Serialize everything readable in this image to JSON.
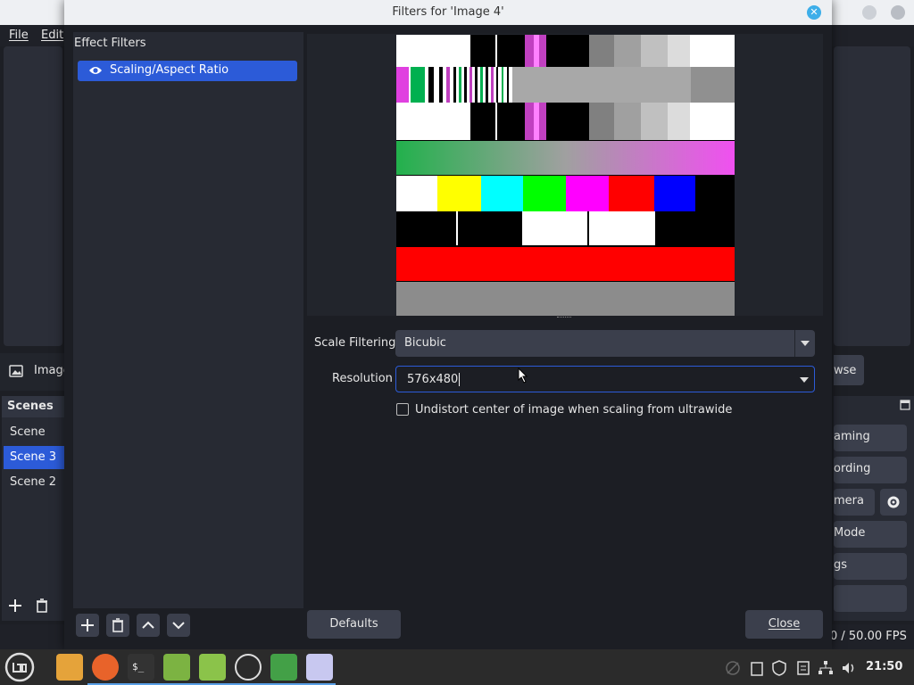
{
  "bg_window": {
    "menu": [
      "File",
      "Edit"
    ],
    "source_label": "Image",
    "scenes_title": "Scenes",
    "scenes": [
      "Scene",
      "Scene 3",
      "Scene 2"
    ],
    "controls": [
      "aming",
      "ording",
      "mera",
      "Mode",
      "gs"
    ],
    "browse_label": "wse",
    "fps": "0 / 50.00 FPS"
  },
  "dialog": {
    "title": "Filters for 'Image 4'",
    "effect_filters_label": "Effect Filters",
    "filters": [
      {
        "label": "Scaling/Aspect Ratio"
      }
    ],
    "scale_filtering_label": "Scale Filtering",
    "scale_filtering_value": "Bicubic",
    "resolution_label": "Resolution",
    "resolution_value": "576x480",
    "undistort_label": "Undistort center of image when scaling from ultrawide",
    "undistort_checked": false,
    "defaults_button": "Defaults",
    "close_button": "Close"
  },
  "taskbar": {
    "clock": "21:50"
  },
  "colors": {
    "accent": "#2c5bd8",
    "panel": "#272a33",
    "bg": "#1c1e24"
  }
}
